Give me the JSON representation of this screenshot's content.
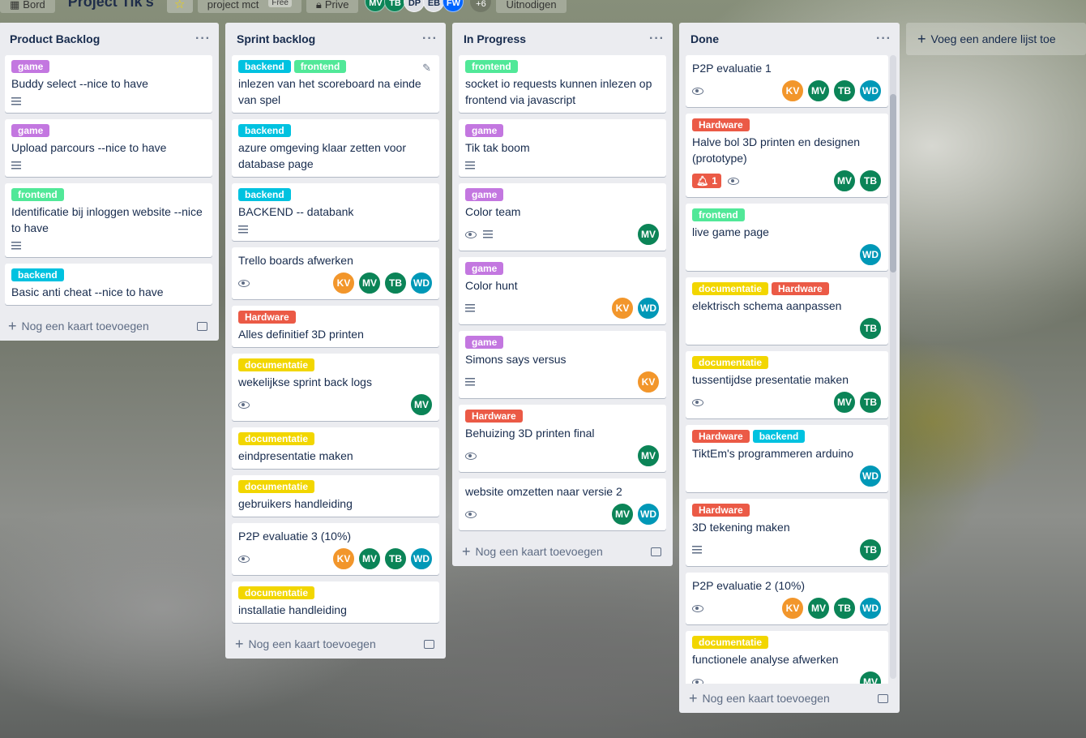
{
  "header": {
    "board_button": "Bord",
    "title": "Project Tik's",
    "team": "project mct",
    "team_plan": "Free",
    "visibility": "Prive",
    "members": [
      {
        "initials": "MV",
        "color": "#0b8457"
      },
      {
        "initials": "TB",
        "color": "#0b8457"
      },
      {
        "initials": "DP",
        "color": "#dfe1e6",
        "text": "#172b4d"
      },
      {
        "initials": "EB",
        "color": "#dfe1e6",
        "text": "#172b4d"
      },
      {
        "initials": "FW",
        "color": "#0065ff"
      }
    ],
    "more_members": "+6",
    "invite": "Uitnodigen"
  },
  "colors": {
    "game": "#c377e0",
    "frontend": "#51e898",
    "backend": "#00c2e0",
    "Hardware": "#eb5a46",
    "documentatie": "#f2d600",
    "KV": "#f2962b",
    "MV": "#0b8457",
    "TB": "#0b8457",
    "WD": "#0098b7"
  },
  "add_card_label": "Nog een kaart toevoegen",
  "add_list_label": "Voeg een andere lijst toe",
  "lists": [
    {
      "title": "Product Backlog",
      "cards": [
        {
          "labels": [
            "game"
          ],
          "title": "Buddy select --nice to have",
          "desc": true,
          "watch": false,
          "members": []
        },
        {
          "labels": [
            "game"
          ],
          "title": "Upload parcours --nice to have",
          "desc": true,
          "watch": false,
          "members": []
        },
        {
          "labels": [
            "frontend"
          ],
          "title": "Identificatie bij inloggen website --nice to have",
          "desc": true,
          "watch": false,
          "members": []
        },
        {
          "labels": [
            "backend"
          ],
          "title": "Basic anti cheat --nice to have",
          "desc": false,
          "watch": false,
          "members": []
        }
      ]
    },
    {
      "title": "Sprint backlog",
      "cards": [
        {
          "labels": [
            "backend",
            "frontend"
          ],
          "title": "inlezen van het scoreboard na einde van spel",
          "desc": false,
          "watch": false,
          "members": [],
          "editing": true
        },
        {
          "labels": [
            "backend"
          ],
          "title": "azure omgeving klaar zetten voor database page",
          "desc": false,
          "watch": false,
          "members": []
        },
        {
          "labels": [
            "backend"
          ],
          "title": "BACKEND -- databank",
          "desc": true,
          "watch": false,
          "members": []
        },
        {
          "labels": [],
          "title": "Trello boards afwerken",
          "desc": false,
          "watch": true,
          "members": [
            "KV",
            "MV",
            "TB",
            "WD"
          ]
        },
        {
          "labels": [
            "Hardware"
          ],
          "title": "Alles definitief 3D printen",
          "desc": false,
          "watch": false,
          "members": []
        },
        {
          "labels": [
            "documentatie"
          ],
          "title": "wekelijkse sprint back logs",
          "desc": false,
          "watch": true,
          "members": [
            "MV"
          ]
        },
        {
          "labels": [
            "documentatie"
          ],
          "title": "eindpresentatie maken",
          "desc": false,
          "watch": false,
          "members": []
        },
        {
          "labels": [
            "documentatie"
          ],
          "title": "gebruikers handleiding",
          "desc": false,
          "watch": false,
          "members": []
        },
        {
          "labels": [],
          "title": "P2P evaluatie 3 (10%)",
          "desc": false,
          "watch": true,
          "members": [
            "KV",
            "MV",
            "TB",
            "WD"
          ]
        },
        {
          "labels": [
            "documentatie"
          ],
          "title": "installatie handleiding",
          "desc": false,
          "watch": false,
          "members": []
        }
      ]
    },
    {
      "title": "In Progress",
      "cards": [
        {
          "labels": [
            "frontend"
          ],
          "title": "socket io requests kunnen inlezen op frontend via javascript",
          "desc": false,
          "watch": false,
          "members": []
        },
        {
          "labels": [
            "game"
          ],
          "title": "Tik tak boom",
          "desc": true,
          "watch": false,
          "members": []
        },
        {
          "labels": [
            "game"
          ],
          "title": "Color team",
          "desc": true,
          "watch": true,
          "members": [
            "MV"
          ]
        },
        {
          "labels": [
            "game"
          ],
          "title": "Color hunt",
          "desc": true,
          "watch": false,
          "members": [
            "KV",
            "WD"
          ]
        },
        {
          "labels": [
            "game"
          ],
          "title": "Simons says versus",
          "desc": true,
          "watch": false,
          "members": [
            "KV"
          ]
        },
        {
          "labels": [
            "Hardware"
          ],
          "title": "Behuizing 3D printen final",
          "desc": false,
          "watch": true,
          "members": [
            "MV"
          ]
        },
        {
          "labels": [],
          "title": "website omzetten naar versie 2",
          "desc": false,
          "watch": true,
          "members": [
            "MV",
            "WD"
          ]
        }
      ]
    },
    {
      "title": "Done",
      "cards": [
        {
          "labels": [],
          "title": "P2P evaluatie 1",
          "desc": false,
          "watch": true,
          "members": [
            "KV",
            "MV",
            "TB",
            "WD"
          ]
        },
        {
          "labels": [
            "Hardware"
          ],
          "title": "Halve bol 3D printen en designen (prototype)",
          "desc": false,
          "watch": true,
          "notif": "1",
          "members": [
            "MV",
            "TB"
          ]
        },
        {
          "labels": [
            "frontend"
          ],
          "title": "live game page",
          "desc": false,
          "watch": false,
          "members": [
            "WD"
          ]
        },
        {
          "labels": [
            "documentatie",
            "Hardware"
          ],
          "title": "elektrisch schema aanpassen",
          "desc": false,
          "watch": false,
          "members": [
            "TB"
          ]
        },
        {
          "labels": [
            "documentatie"
          ],
          "title": "tussentijdse presentatie maken",
          "desc": false,
          "watch": true,
          "members": [
            "MV",
            "TB"
          ]
        },
        {
          "labels": [
            "Hardware",
            "backend"
          ],
          "title": "TiktEm's programmeren arduino",
          "desc": false,
          "watch": false,
          "members": [
            "WD"
          ]
        },
        {
          "labels": [
            "Hardware"
          ],
          "title": "3D tekening maken",
          "desc": true,
          "watch": false,
          "members": [
            "TB"
          ]
        },
        {
          "labels": [],
          "title": "P2P evaluatie 2 (10%)",
          "desc": false,
          "watch": true,
          "members": [
            "KV",
            "MV",
            "TB",
            "WD"
          ]
        },
        {
          "labels": [
            "documentatie"
          ],
          "title": "functionele analyse afwerken",
          "desc": false,
          "watch": true,
          "members": [
            "MV"
          ]
        }
      ]
    }
  ]
}
